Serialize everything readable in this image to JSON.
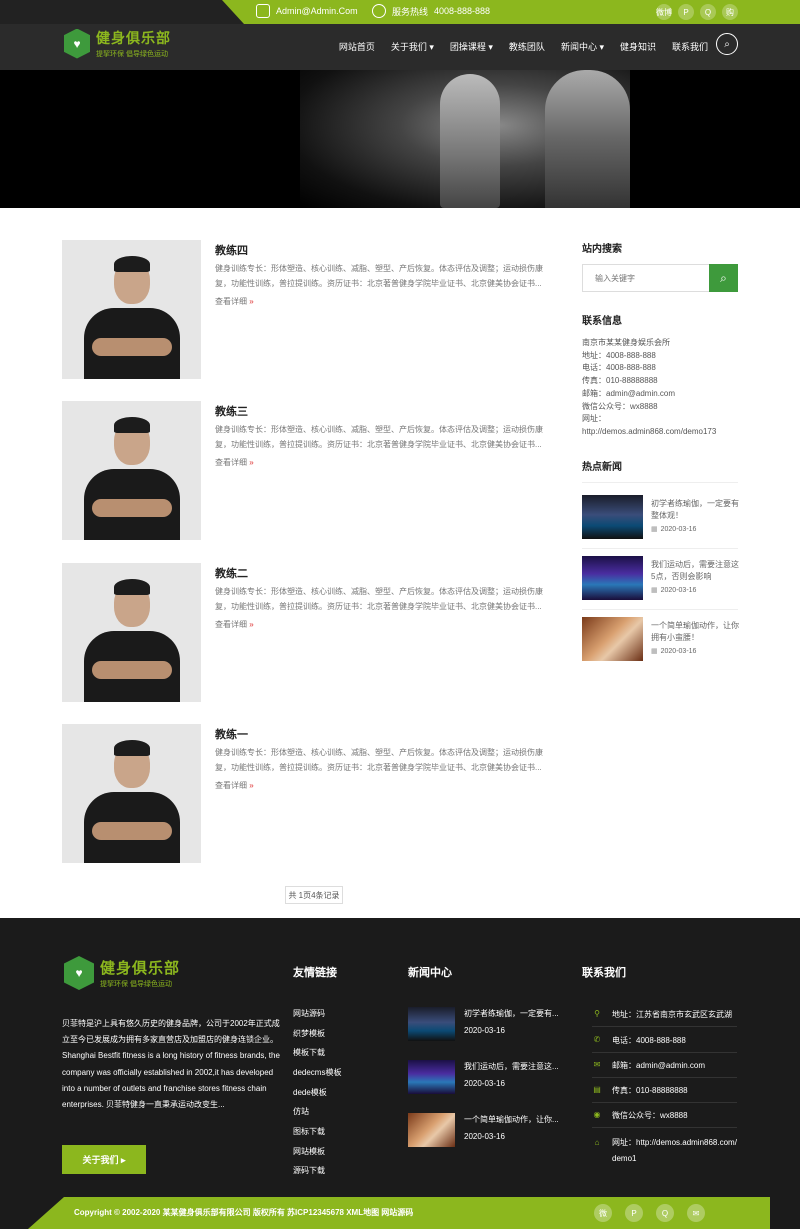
{
  "topbar": {
    "email": "Admin@Admin.Com",
    "hotline_label": "服务热线",
    "hotline": "4008-888-888",
    "social": [
      "微博",
      "P",
      "Q",
      "购"
    ]
  },
  "brand": {
    "name": "健身俱乐部",
    "slogan": "提挈环保 倡导绿色运动"
  },
  "nav": [
    "网站首页",
    "关于我们 ▾",
    "团操课程 ▾",
    "教练团队",
    "新闻中心 ▾",
    "健身知识",
    "联系我们"
  ],
  "coaches": [
    {
      "name": "教练四",
      "desc": "健身训练专长：形体塑造、核心训练、减脂、塑型、产后恢复。体态评估及调整；运动损伤康复，功能性训练，普拉提训练。资历证书：北京著普健身学院毕业证书、北京健美协会证书...",
      "more": "查看详细"
    },
    {
      "name": "教练三",
      "desc": "健身训练专长：形体塑造、核心训练、减脂、塑型、产后恢复。体态评估及调整；运动损伤康复，功能性训练，普拉提训练。资历证书：北京著普健身学院毕业证书、北京健美协会证书...",
      "more": "查看详细"
    },
    {
      "name": "教练二",
      "desc": "健身训练专长：形体塑造、核心训练、减脂、塑型、产后恢复。体态评估及调整；运动损伤康复，功能性训练，普拉提训练。资历证书：北京著普健身学院毕业证书、北京健美协会证书...",
      "more": "查看详细"
    },
    {
      "name": "教练一",
      "desc": "健身训练专长：形体塑造、核心训练、减脂、塑型、产后恢复。体态评估及调整；运动损伤康复，功能性训练，普拉提训练。资历证书：北京著普健身学院毕业证书、北京健美协会证书...",
      "more": "查看详细"
    }
  ],
  "pager": "共 1页4条记录",
  "sidebar": {
    "search_title": "站内搜索",
    "search_placeholder": "输入关键字",
    "contact_title": "联系信息",
    "contact_lines": [
      "南京市某某健身娱乐会所",
      "地址：4008-888-888",
      "电话：4008-888-888",
      "传真：010-88888888",
      "邮箱：admin@admin.com",
      "微信公众号：wx8888",
      "网址：",
      "http://demos.admin868.com/demo173"
    ],
    "news_title": "热点新闻",
    "news": [
      {
        "title": "初学者练瑜伽，一定要有整体观！",
        "date": "2020-03-16"
      },
      {
        "title": "我们运动后，需要注意这5点，否则会影响",
        "date": "2020-03-16"
      },
      {
        "title": "一个简单瑜伽动作，让你拥有小蛮腰！",
        "date": "2020-03-16"
      }
    ]
  },
  "footer": {
    "about": "贝菲特是沪上具有悠久历史的健身品牌，公司于2002年正式成立至今已发展成为拥有多家直营店及加盟店的健身连锁企业。 Shanghai Bestfit fitness is a long history of fitness brands, the company was officially established in 2002,it has developed into a number of outlets and franchise stores fitness chain enterprises. 贝菲特健身一直秉承运动改变生...",
    "about_btn": "关于我们 ▸",
    "links_title": "友情链接",
    "links": [
      "网站源码",
      "织梦模板",
      "模板下载",
      "dedecms模板",
      "dede模板",
      "仿站",
      "图标下载",
      "网站模板",
      "源码下载"
    ],
    "news_title": "新闻中心",
    "news": [
      {
        "title": "初学者练瑜伽，一定要有...",
        "date": "2020-03-16"
      },
      {
        "title": "我们运动后，需要注意这...",
        "date": "2020-03-16"
      },
      {
        "title": "一个简单瑜伽动作，让你...",
        "date": "2020-03-16"
      }
    ],
    "contact_title": "联系我们",
    "contact": [
      {
        "icon": "⚲",
        "text": "地址：江苏省南京市玄武区玄武湖"
      },
      {
        "icon": "✆",
        "text": "电话：4008-888-888"
      },
      {
        "icon": "✉",
        "text": "邮箱：admin@admin.com"
      },
      {
        "icon": "▤",
        "text": "传真：010-88888888"
      },
      {
        "icon": "◉",
        "text": "微信公众号：wx8888"
      },
      {
        "icon": "⌂",
        "text": "网址：http://demos.admin868.com/demo1"
      }
    ],
    "copyright": "Copyright © 2002-2020 某某健身俱乐部有限公司 版权所有 苏ICP12345678 XML地图 网站源码",
    "social": [
      "微",
      "P",
      "Q",
      "✉"
    ]
  },
  "colors": {
    "accent": "#8cb71e",
    "green": "#3e9a3c",
    "dark": "#1b1b1b"
  }
}
